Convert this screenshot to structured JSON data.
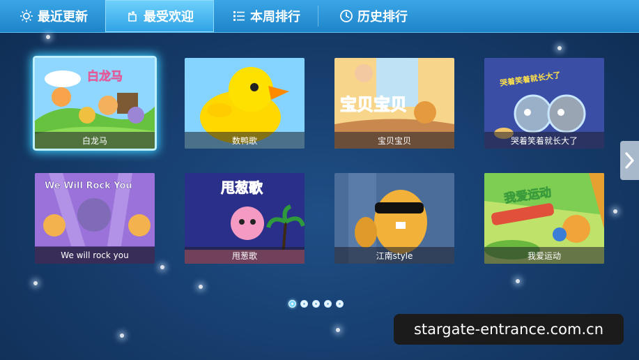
{
  "tabs": [
    {
      "label": "最近更新",
      "icon": "sun-icon"
    },
    {
      "label": "最受欢迎",
      "icon": "hand-icon"
    },
    {
      "label": "本周排行",
      "icon": "list-icon"
    },
    {
      "label": "历史排行",
      "icon": "clock-icon"
    }
  ],
  "active_tab": "最受欢迎",
  "videos": [
    {
      "title": "白龙马",
      "art_text": "白龙马"
    },
    {
      "title": "数鸭歌",
      "art_text": ""
    },
    {
      "title": "宝贝宝贝",
      "art_text": "宝贝宝贝"
    },
    {
      "title": "哭着笑着就长大了",
      "art_text": "哭着笑着就长大了"
    },
    {
      "title": "We will rock you",
      "art_text": "We Will Rock You"
    },
    {
      "title": "甩葱歌",
      "art_text": "甩葱歌"
    },
    {
      "title": "江南style",
      "art_text": ""
    },
    {
      "title": "我爱运动",
      "art_text": "我爱运动"
    }
  ],
  "selected_video": "白龙马",
  "pagination": {
    "pages": 5,
    "current": 1
  },
  "watermark": "stargate-entrance.com.cn",
  "colors": {
    "tab_bar": "#2b96d8",
    "tab_active": "#5fc6f7",
    "background": "#173e6e",
    "highlight": "#3fd0ff"
  }
}
